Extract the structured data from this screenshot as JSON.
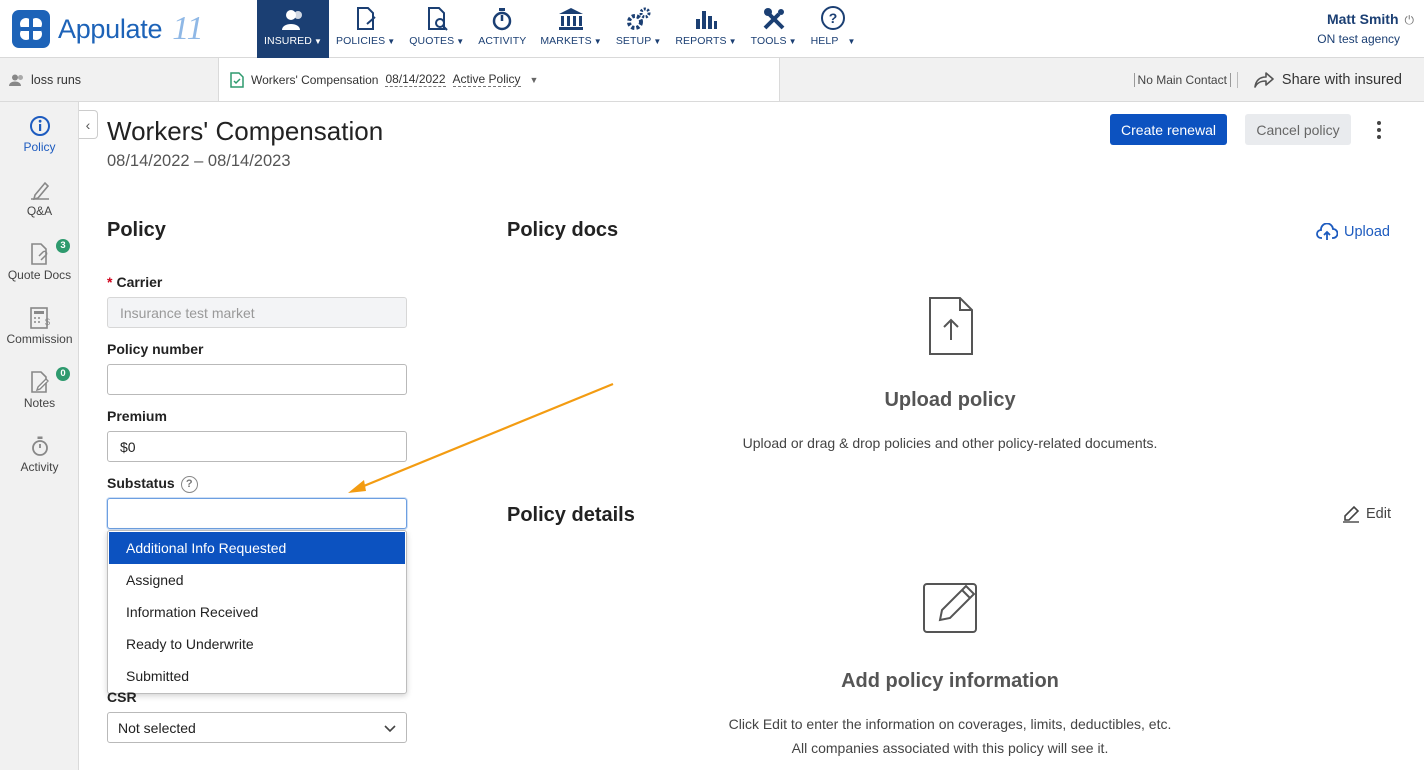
{
  "brand": {
    "name": "Appulate",
    "version": "11"
  },
  "nav": [
    {
      "label": "INSURED",
      "icon": "people-icon",
      "active": true
    },
    {
      "label": "POLICIES",
      "icon": "policy-doc-icon"
    },
    {
      "label": "QUOTES",
      "icon": "quote-doc-icon"
    },
    {
      "label": "ACTIVITY",
      "icon": "stopwatch-icon"
    },
    {
      "label": "MARKETS",
      "icon": "bank-icon"
    },
    {
      "label": "SETUP",
      "icon": "gears-icon"
    },
    {
      "label": "REPORTS",
      "icon": "bar-chart-icon"
    },
    {
      "label": "TOOLS",
      "icon": "tools-icon"
    },
    {
      "label": "HELP",
      "icon": "question-circle-icon"
    }
  ],
  "user": {
    "name": "Matt Smith",
    "agency": "ON test agency"
  },
  "subbar": {
    "insured": "loss runs",
    "policy_type": "Workers' Compensation",
    "policy_date": "08/14/2022",
    "policy_status": "Active Policy",
    "main_contact": "No Main Contact",
    "share": "Share with insured"
  },
  "rail": [
    {
      "label": "Policy",
      "icon": "info-circle-icon",
      "active": true
    },
    {
      "label": "Q&A",
      "icon": "pen-sign-icon"
    },
    {
      "label": "Quote Docs",
      "icon": "attachment-doc-icon",
      "badge": "3"
    },
    {
      "label": "Commission",
      "icon": "calculator-icon"
    },
    {
      "label": "Notes",
      "icon": "note-edit-icon",
      "badge": "0"
    },
    {
      "label": "Activity",
      "icon": "stopwatch-icon"
    }
  ],
  "header": {
    "title": "Workers' Compensation",
    "dates": "08/14/2022 – 08/14/2023",
    "create_renewal": "Create renewal",
    "cancel_policy": "Cancel policy"
  },
  "policy_form": {
    "heading": "Policy",
    "carrier_label": "Carrier",
    "carrier_required": "*",
    "carrier_value": "Insurance test market",
    "policy_number_label": "Policy number",
    "policy_number_value": "",
    "premium_label": "Premium",
    "premium_value": "$0",
    "substatus_label": "Substatus",
    "substatus_help": "?",
    "substatus_value": "",
    "substatus_options": [
      "Additional Info Requested",
      "Assigned",
      "Information Received",
      "Ready to Underwrite",
      "Submitted"
    ],
    "substatus_highlighted": "Additional Info Requested",
    "csr_label": "CSR",
    "csr_value": "Not selected"
  },
  "policy_docs": {
    "heading": "Policy docs",
    "upload_label": "Upload",
    "empty_title": "Upload policy",
    "empty_text": "Upload or drag & drop policies and other policy-related documents."
  },
  "policy_details": {
    "heading": "Policy details",
    "edit_label": "Edit",
    "empty_title": "Add policy information",
    "empty_text_1": "Click Edit to enter the information on coverages, limits, deductibles, etc.",
    "empty_text_2": "All companies associated with this policy will see it."
  },
  "colors": {
    "accent": "#0c52c0",
    "nav": "#1b3f73",
    "badge": "#2e9a6e",
    "annotation": "#f39c12"
  }
}
